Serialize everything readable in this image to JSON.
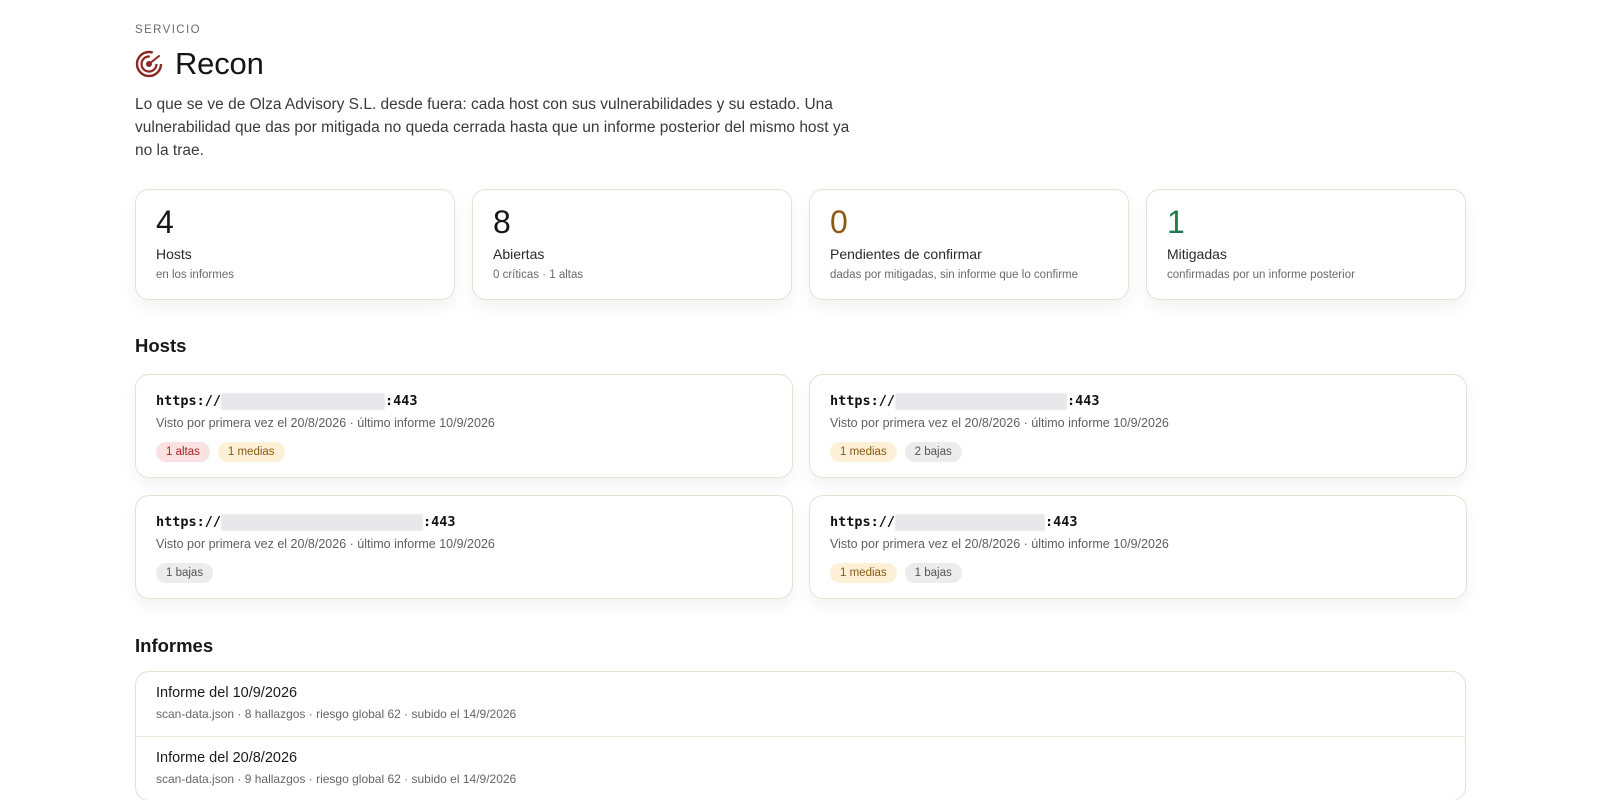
{
  "header": {
    "kicker": "SERVICIO",
    "title": "Recon",
    "title_icon": "radar-target-icon",
    "accent_color": "#8b2a22",
    "description": "Lo que se ve de Olza Advisory S.L. desde fuera: cada host con sus vulnerabilidades y su estado. Una vulnerabilidad que das por mitigada no queda cerrada hasta que un informe posterior del mismo host ya no la trae."
  },
  "stats": [
    {
      "value": "4",
      "label": "Hosts",
      "sub": "en los informes",
      "color": "#161616"
    },
    {
      "value": "8",
      "label": "Abiertas",
      "sub": "0 críticas · 1 altas",
      "color": "#161616"
    },
    {
      "value": "0",
      "label": "Pendientes de confirmar",
      "sub": "dadas por mitigadas, sin informe que lo confirme",
      "color": "#8a5b12"
    },
    {
      "value": "1",
      "label": "Mitigadas",
      "sub": "confirmadas por un informe posterior",
      "color": "#1f7a4d"
    }
  ],
  "hosts_section": {
    "title": "Hosts",
    "hosts": [
      {
        "scheme": "https://",
        "port": ":443",
        "seen": "Visto por primera vez el 20/8/2026 · último informe 10/9/2026",
        "chips": [
          {
            "label": "1 altas",
            "level": "high"
          },
          {
            "label": "1 medias",
            "level": "med"
          }
        ]
      },
      {
        "scheme": "https://",
        "port": ":443",
        "seen": "Visto por primera vez el 20/8/2026 · último informe 10/9/2026",
        "chips": [
          {
            "label": "1 medias",
            "level": "med"
          },
          {
            "label": "2 bajas",
            "level": "low"
          }
        ]
      },
      {
        "scheme": "https://",
        "port": ":443",
        "seen": "Visto por primera vez el 20/8/2026 · último informe 10/9/2026",
        "chips": [
          {
            "label": "1 bajas",
            "level": "low"
          }
        ]
      },
      {
        "scheme": "https://",
        "port": ":443",
        "seen": "Visto por primera vez el 20/8/2026 · último informe 10/9/2026",
        "chips": [
          {
            "label": "1 medias",
            "level": "med"
          },
          {
            "label": "1 bajas",
            "level": "low"
          }
        ]
      }
    ]
  },
  "reports_section": {
    "title": "Informes",
    "reports": [
      {
        "title": "Informe del 10/9/2026",
        "meta": "scan-data.json · 8 hallazgos · riesgo global 62 · subido el 14/9/2026"
      },
      {
        "title": "Informe del 20/8/2026",
        "meta": "scan-data.json · 9 hallazgos · riesgo global 62 · subido el 14/9/2026"
      }
    ]
  }
}
